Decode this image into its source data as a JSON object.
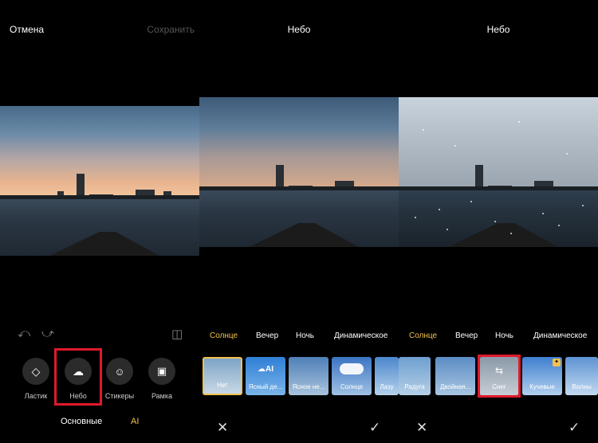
{
  "panel1": {
    "cancel": "Отмена",
    "save": "Сохранить",
    "undo_icon": "undo-icon",
    "redo_icon": "redo-icon",
    "compare_icon": "compare-icon",
    "tools": [
      {
        "label": "Ластик",
        "icon": "eraser-icon"
      },
      {
        "label": "Небо",
        "icon": "cloud-icon"
      },
      {
        "label": "Стикеры",
        "icon": "sticker-icon"
      },
      {
        "label": "Рамка",
        "icon": "frame-icon"
      }
    ],
    "tabs": [
      "Основные",
      "AI"
    ]
  },
  "panel2": {
    "title": "Небо",
    "categories": [
      "Солнце",
      "Вечер",
      "Ночь",
      "Динамическое"
    ],
    "thumbs": [
      "Нет",
      "Ясный де...",
      "Ясное не...",
      "Солнце",
      "Лазу"
    ],
    "close_icon": "close-icon",
    "confirm_icon": "checkmark-icon"
  },
  "panel3": {
    "title": "Небо",
    "categories": [
      "Солнце",
      "Вечер",
      "Ночь",
      "Динамическое"
    ],
    "thumbs": [
      "Радуга",
      "Двойная...",
      "Снег",
      "Кучевые",
      "Волны"
    ],
    "close_icon": "close-icon",
    "confirm_icon": "checkmark-icon"
  },
  "colors": {
    "accent": "#f4c04d",
    "highlight": "#e0192b",
    "badge": "#f4c04d"
  }
}
